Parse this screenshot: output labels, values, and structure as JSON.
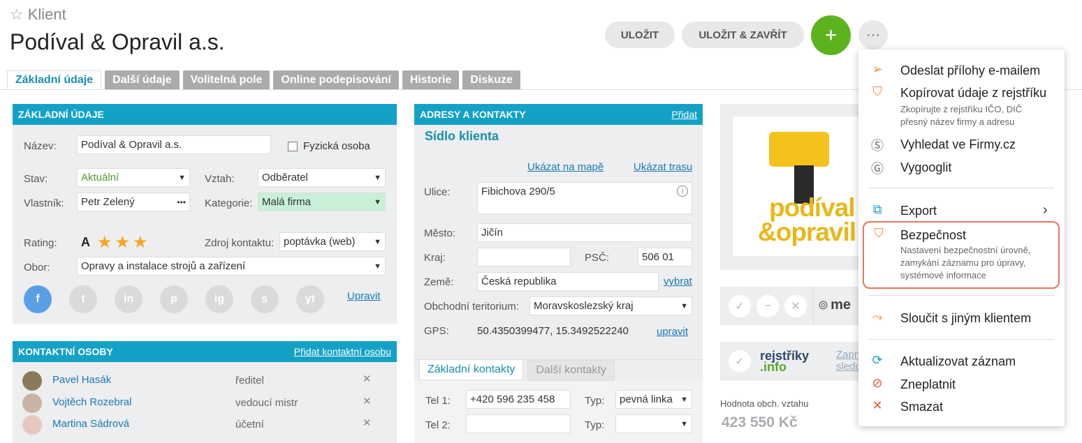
{
  "header": {
    "star_icon": "star-outline-icon",
    "subtitle": "Klient",
    "title": "Podíval & Opravil a.s.",
    "save": "ULOŽIT",
    "save_close": "ULOŽIT & ZAVŘÍT",
    "plus": "+",
    "more": "···"
  },
  "tabs": [
    "Základní údaje",
    "Další údaje",
    "Volitelná pole",
    "Online podepisování",
    "Historie",
    "Diskuze"
  ],
  "basic": {
    "heading": "ZÁKLADNÍ ÚDAJE",
    "name_label": "Název:",
    "name_value": "Podíval & Opravil a.s.",
    "person_label": "Fyzická osoba",
    "state_label": "Stav:",
    "state_value": "Aktuální",
    "relation_label": "Vztah:",
    "relation_value": "Odběratel",
    "owner_label": "Vlastník:",
    "owner_value": "Petr Zelený",
    "owner_more": "•••",
    "category_label": "Kategorie:",
    "category_value": "Malá firma",
    "rating_label": "Rating:",
    "rating_value": "A",
    "rating_stars": 3,
    "source_label": "Zdroj kontaktu:",
    "source_value": "poptávka (web)",
    "field_label": "Obor:",
    "field_value": "Opravy a instalace strojů a zařízení",
    "edit": "Upravit",
    "social": [
      "f",
      "t",
      "in",
      "p",
      "ig",
      "s",
      "yt"
    ],
    "social_icons": [
      "facebook-icon",
      "twitter-icon",
      "linkedin-icon",
      "pinterest-icon",
      "instagram-icon",
      "skype-icon",
      "youtube-icon"
    ]
  },
  "contacts": {
    "heading": "KONTAKTNÍ OSOBY",
    "add": "Přidat kontaktní osobu",
    "rows": [
      {
        "name": "Pavel Hasák",
        "role": "ředitel"
      },
      {
        "name": "Vojtěch Rozebral",
        "role": "vedoucí mistr"
      },
      {
        "name": "Martina Sádrová",
        "role": "účetní"
      }
    ],
    "remove": "✕"
  },
  "address": {
    "heading": "ADRESY A KONTAKTY",
    "add": "Přidat",
    "section": "Sídlo klienta",
    "map": "Ukázat na mapě",
    "route": "Ukázat trasu",
    "street_label": "Ulice:",
    "street_value": "Fibichova 290/5",
    "city_label": "Město:",
    "city_value": "Jičín",
    "region_label": "Kraj:",
    "region_value": "",
    "zip_label": "PSČ:",
    "zip_value": "506 01",
    "country_label": "Země:",
    "country_value": "Česká republika",
    "choose": "vybrat",
    "territory_label": "Obchodní teritorium:",
    "territory_value": "Moravskoslezský kraj",
    "gps_label": "GPS:",
    "gps_value": "50.4350399477, 15.3492522240",
    "gps_edit": "upravit",
    "tab_basic": "Základní kontakty",
    "tab_more": "Další kontakty",
    "tel1_label": "Tel 1:",
    "tel1_value": "+420 596 235 458",
    "type_label": "Typ:",
    "type1_value": "pevná linka",
    "tel2_label": "Tel 2:",
    "tel2_value": "",
    "type2_value": ""
  },
  "right": {
    "logo_line1": "podíval",
    "logo_line2": "&opravil",
    "me": "me",
    "rejstriky_1": "rejstříky",
    "rejstriky_2": ".info",
    "zapn": "Zapn",
    "sledo": "sledo",
    "value_label": "Hodnota obch. vztahu",
    "value": "423 550 Kč"
  },
  "menu": {
    "items": [
      {
        "icon": "send-icon",
        "label": "Odeslat přílohy e-mailem"
      },
      {
        "icon": "shield-copy-icon",
        "label": "Kopírovat údaje z rejstříku",
        "desc": "Zkopírujte z rejstříku IČO, DIČ přesný název firmy a adresu"
      },
      {
        "icon": "firmy-icon",
        "label": "Vyhledat ve Firmy.cz"
      },
      {
        "icon": "google-icon",
        "label": "Vygooglit"
      },
      {
        "icon": "export-icon",
        "label": "Export",
        "chevron": "›"
      },
      {
        "icon": "shield-check-icon",
        "label": "Bezpečnost",
        "desc": "Nastavení bezpečnostní úrovně, zamykání záznamu pro úpravy, systémové informace"
      },
      {
        "icon": "merge-icon",
        "label": "Sloučit s jiným klientem"
      },
      {
        "icon": "refresh-icon",
        "label": "Aktualizovat záznam"
      },
      {
        "icon": "eye-off-icon",
        "label": "Zneplatnit"
      },
      {
        "icon": "close-icon",
        "label": "Smazat"
      }
    ]
  },
  "colors": {
    "accent": "#13a2c6",
    "green": "#5db31e",
    "orange": "#f08a3c",
    "highlight": "#e8735a"
  }
}
